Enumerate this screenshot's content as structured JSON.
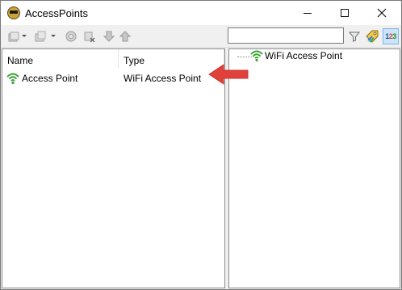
{
  "window": {
    "title": "AccessPoints"
  },
  "toolbar": {
    "buttons": [
      "new-dropdown",
      "open-dropdown",
      "settings",
      "delete",
      "move-down",
      "move-up"
    ],
    "search": {
      "value": "",
      "placeholder": ""
    },
    "right_buttons": [
      "filter",
      "tag-color",
      "numbering"
    ],
    "numbering_label": {
      "d1": "1",
      "d2": "2",
      "d3": "3"
    }
  },
  "list": {
    "columns": [
      "Name",
      "Type"
    ],
    "rows": [
      {
        "name": "Access Point",
        "type": "WiFi Access Point",
        "icon": "wifi-icon"
      }
    ]
  },
  "tree": {
    "items": [
      {
        "label": "WiFi Access Point",
        "icon": "wifi-icon"
      }
    ]
  },
  "colors": {
    "wifi_green": "#3aa334",
    "arrow_red": "#e0413a",
    "selected_button_bg": "#cce4f7"
  }
}
